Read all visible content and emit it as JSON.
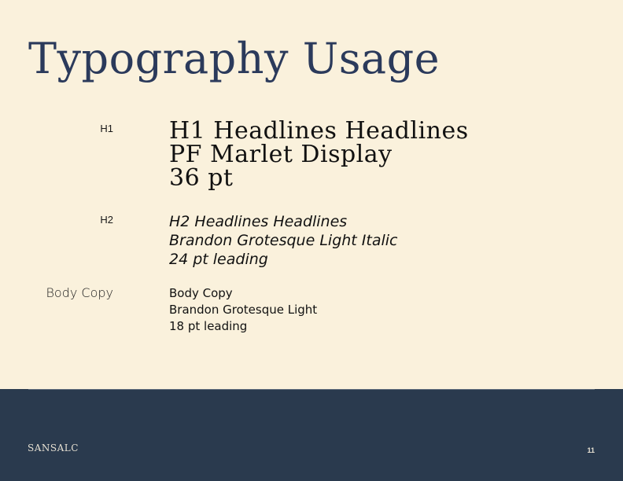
{
  "slide": {
    "title": "Typography Usage",
    "page_number": "11"
  },
  "rows": {
    "h1": {
      "label": "H1",
      "lines": [
        "H1 Headlines Headlines",
        "PF Marlet Display",
        "36 pt"
      ]
    },
    "h2": {
      "label": "H2",
      "lines": [
        "H2 Headlines Headlines",
        "Brandon Grotesque Light Italic",
        "24 pt leading"
      ]
    },
    "body": {
      "label": "Body Copy",
      "lines": [
        "Body Copy",
        "Brandon Grotesque Light",
        "18 pt leading"
      ]
    }
  },
  "footer": {
    "brand": "SANSALC"
  },
  "colors": {
    "background": "#faf1dc",
    "title": "#2b3a5b",
    "footer_background": "#2a3a4e",
    "footer_text": "#e6e0d2"
  }
}
